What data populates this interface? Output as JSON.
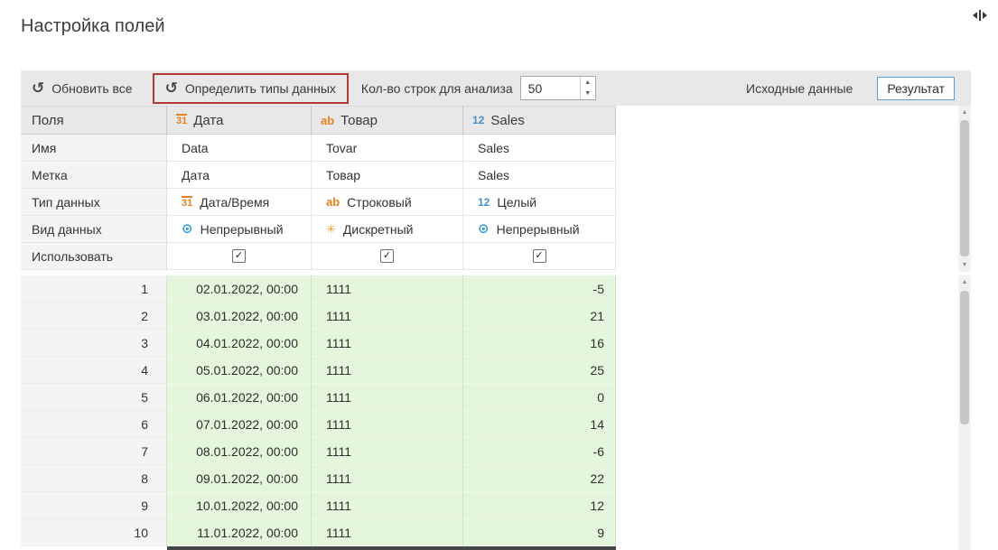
{
  "page": {
    "title": "Настройка полей"
  },
  "icons": {
    "refresh": "↺",
    "detect_types": "↺",
    "continuous": "⊙",
    "discrete": "✳",
    "check": "✓",
    "spin_up": "▲",
    "spin_down": "▼",
    "scroll_up": "▲",
    "scroll_down": "▼"
  },
  "colors": {
    "accent_orange": "#E8821E",
    "accent_blue": "#4A8FC7",
    "highlight_red": "#B23A2E",
    "result_border_blue": "#58A0D6",
    "data_cell_green": "#E4F6DB",
    "toolbar_gray": "#E8E8E8"
  },
  "toolbar": {
    "refresh_all": "Обновить все",
    "detect_types": "Определить типы данных",
    "rows_label": "Кол-во строк для анализа",
    "rows_value": "50",
    "source_data": "Исходные данные",
    "result": "Результат"
  },
  "table": {
    "fields_header": "Поля",
    "columns": [
      {
        "icon": "31",
        "label": "Дата"
      },
      {
        "icon": "ab",
        "label": "Товар"
      },
      {
        "icon": "12",
        "label": "Sales"
      }
    ],
    "rows": {
      "name": {
        "label": "Имя",
        "values": [
          "Data",
          "Tovar",
          "Sales"
        ]
      },
      "caption": {
        "label": "Метка",
        "values": [
          "Дата",
          "Товар",
          "Sales"
        ]
      },
      "type": {
        "label": "Тип данных",
        "values": [
          {
            "icon": "31",
            "text": "Дата/Время"
          },
          {
            "icon": "ab",
            "text": "Строковый"
          },
          {
            "icon": "12",
            "text": "Целый"
          }
        ]
      },
      "kind": {
        "label": "Вид данных",
        "values": [
          {
            "kind": "continuous",
            "text": "Непрерывный"
          },
          {
            "kind": "discrete",
            "text": "Дискретный"
          },
          {
            "kind": "continuous",
            "text": "Непрерывный"
          }
        ]
      },
      "use": {
        "label": "Использовать",
        "checked": [
          true,
          true,
          true
        ]
      }
    },
    "data": [
      {
        "n": "1",
        "date": "02.01.2022, 00:00",
        "product": "1111",
        "sales": "-5"
      },
      {
        "n": "2",
        "date": "03.01.2022, 00:00",
        "product": "1111",
        "sales": "21"
      },
      {
        "n": "3",
        "date": "04.01.2022, 00:00",
        "product": "1111",
        "sales": "16"
      },
      {
        "n": "4",
        "date": "05.01.2022, 00:00",
        "product": "1111",
        "sales": "25"
      },
      {
        "n": "5",
        "date": "06.01.2022, 00:00",
        "product": "1111",
        "sales": "0"
      },
      {
        "n": "6",
        "date": "07.01.2022, 00:00",
        "product": "1111",
        "sales": "14"
      },
      {
        "n": "7",
        "date": "08.01.2022, 00:00",
        "product": "1111",
        "sales": "-6"
      },
      {
        "n": "8",
        "date": "09.01.2022, 00:00",
        "product": "1111",
        "sales": "22"
      },
      {
        "n": "9",
        "date": "10.01.2022, 00:00",
        "product": "1111",
        "sales": "12"
      },
      {
        "n": "10",
        "date": "11.01.2022, 00:00",
        "product": "1111",
        "sales": "9"
      }
    ]
  }
}
